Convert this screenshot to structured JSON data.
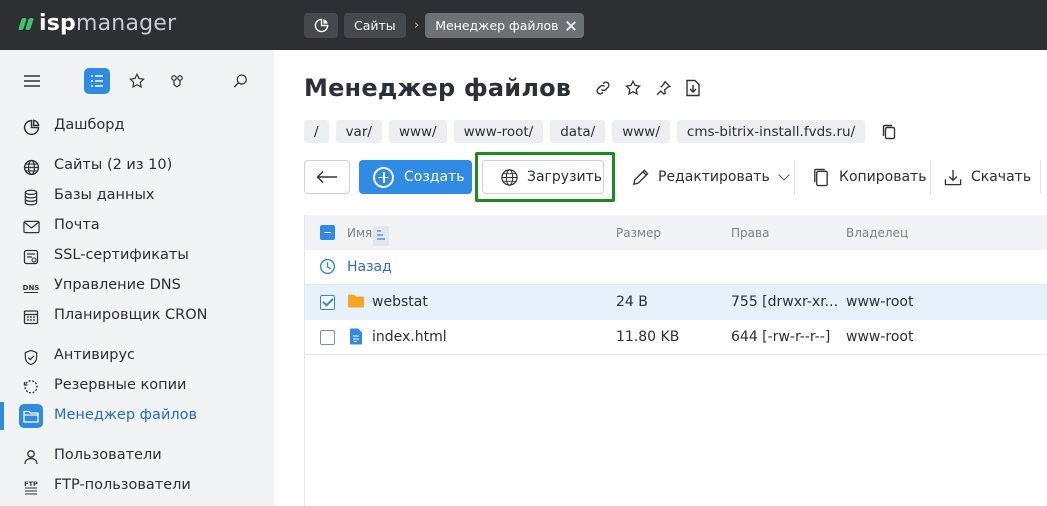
{
  "brand": {
    "isp": "isp",
    "manager": "manager"
  },
  "breadcrumbs": [
    {
      "label": "Сайты"
    },
    {
      "label": "Менеджер файлов"
    }
  ],
  "sidebar": {
    "items": [
      {
        "label": "Дашборд",
        "icon": "dashboard-icon"
      },
      {
        "label": "Сайты (2 из 10)",
        "icon": "globe-icon"
      },
      {
        "label": "Базы данных",
        "icon": "database-icon"
      },
      {
        "label": "Почта",
        "icon": "mail-icon"
      },
      {
        "label": "SSL-сертификаты",
        "icon": "certificate-icon"
      },
      {
        "label": "Управление DNS",
        "icon": "dns-icon"
      },
      {
        "label": "Планировщик CRON",
        "icon": "calendar-icon"
      },
      {
        "label": "Антивирус",
        "icon": "shield-icon"
      },
      {
        "label": "Резервные копии",
        "icon": "backup-icon"
      },
      {
        "label": "Менеджер файлов",
        "icon": "folder-icon",
        "active": true
      },
      {
        "label": "Пользователи",
        "icon": "user-icon"
      },
      {
        "label": "FTP-пользователи",
        "icon": "ftp-icon"
      }
    ]
  },
  "page": {
    "title": "Менеджер файлов",
    "path": [
      "/",
      "var/",
      "www/",
      "www-root/",
      "data/",
      "www/",
      "cms-bitrix-install.fvds.ru/"
    ]
  },
  "toolbar": {
    "create": "Создать",
    "upload": "Загрузить",
    "edit": "Редактировать",
    "copy": "Копировать",
    "download": "Скачать"
  },
  "table": {
    "columns": {
      "name": "Имя",
      "size": "Размер",
      "perms": "Права",
      "owner": "Владелец"
    },
    "back_label": "Назад",
    "rows": [
      {
        "name": "webstat",
        "size": "24 B",
        "perms": "755 [drwxr-xr...",
        "owner": "www-root",
        "type": "folder",
        "selected": true
      },
      {
        "name": "index.html",
        "size": "11.80 KB",
        "perms": "644 [-rw-r--r--]",
        "owner": "www-root",
        "type": "file",
        "selected": false
      }
    ]
  },
  "colors": {
    "accent": "#2f8be3",
    "highlight": "#1f8a1f",
    "topbar": "#2d2f32",
    "folder": "#f5a623"
  }
}
